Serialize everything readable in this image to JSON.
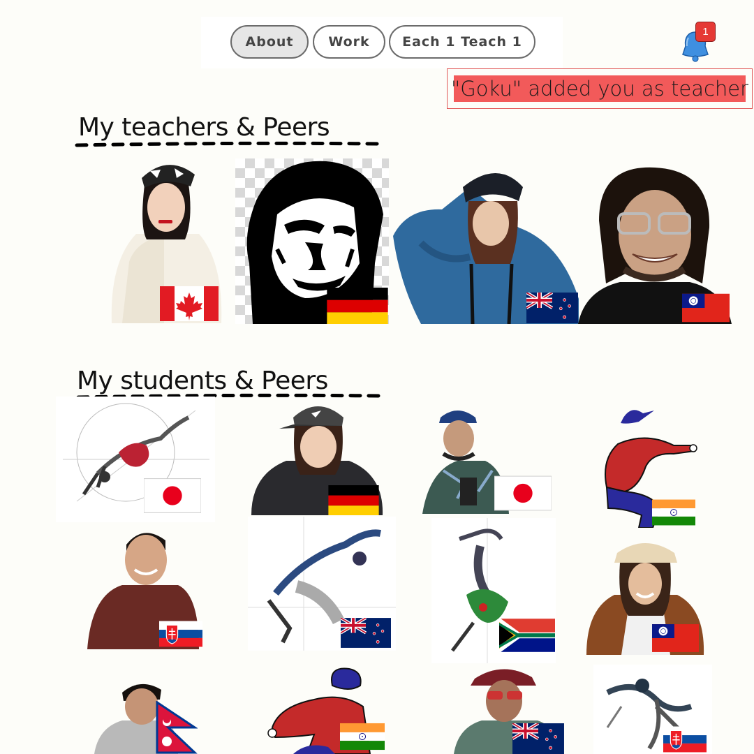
{
  "nav": {
    "about_label": "About",
    "work_label": "Work",
    "each1_label": "Each 1 Teach 1",
    "active": "About"
  },
  "notifications": {
    "count": "1",
    "message": "\"Goku\" added you as teacher"
  },
  "sections": {
    "teachers_title": "My teachers & Peers",
    "students_title": "My students & Peers"
  },
  "teachers": [
    {
      "kind": "photo",
      "flag": "canada"
    },
    {
      "kind": "stencil-portrait",
      "flag": "germany"
    },
    {
      "kind": "photo",
      "flag": "new-zealand"
    },
    {
      "kind": "photo",
      "flag": "taiwan"
    }
  ],
  "students": [
    {
      "kind": "sketch",
      "flag": "japan"
    },
    {
      "kind": "photo",
      "flag": "germany"
    },
    {
      "kind": "photo",
      "flag": "japan"
    },
    {
      "kind": "illustration",
      "flag": "india"
    },
    {
      "kind": "photo",
      "flag": "slovakia"
    },
    {
      "kind": "sketch",
      "flag": "new-zealand"
    },
    {
      "kind": "sketch",
      "flag": "south-africa"
    },
    {
      "kind": "photo",
      "flag": "taiwan"
    },
    {
      "kind": "photo",
      "flag": "nepal"
    },
    {
      "kind": "illustration",
      "flag": "india"
    },
    {
      "kind": "photo",
      "flag": "new-zealand"
    },
    {
      "kind": "sketch",
      "flag": "slovakia"
    }
  ],
  "colors": {
    "background": "#fdfdf9",
    "notification_fill": "#f25a5a",
    "notification_border": "#e05555",
    "badge": "#e53935",
    "bell": "#3f8fe0"
  }
}
